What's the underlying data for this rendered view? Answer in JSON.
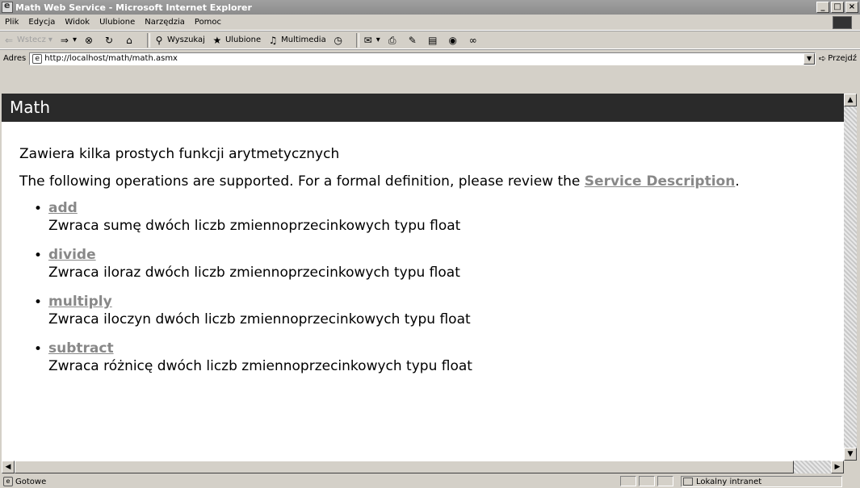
{
  "window": {
    "title": "Math Web Service - Microsoft Internet Explorer",
    "buttons": [
      "_",
      "□",
      "×"
    ]
  },
  "menubar": {
    "items": [
      "Plik",
      "Edycja",
      "Widok",
      "Ulubione",
      "Narzędzia",
      "Pomoc"
    ]
  },
  "toolbar": {
    "back": "Wstecz",
    "search": "Wyszukaj",
    "favorites": "Ulubione",
    "multimedia": "Multimedia"
  },
  "address": {
    "label": "Adres",
    "url": "http://localhost/math/math.asmx",
    "go": "Przejdź"
  },
  "page": {
    "header": "Math",
    "intro": "Zawiera kilka prostych funkcji arytmetycznych",
    "ops_text_before": "The following operations are supported. For a formal definition, please review the ",
    "service_description": "Service Description",
    "ops_text_after": ".",
    "operations": [
      {
        "name": "add",
        "desc": "Zwraca sumę dwóch liczb zmiennoprzecinkowych typu float"
      },
      {
        "name": "divide",
        "desc": "Zwraca iloraz dwóch liczb zmiennoprzecinkowych typu float"
      },
      {
        "name": "multiply",
        "desc": "Zwraca iloczyn dwóch liczb zmiennoprzecinkowych typu float"
      },
      {
        "name": "subtract",
        "desc": "Zwraca różnicę dwóch liczb zmiennoprzecinkowych typu float"
      }
    ]
  },
  "status": {
    "text": "Gotowe",
    "zone": "Lokalny intranet"
  }
}
